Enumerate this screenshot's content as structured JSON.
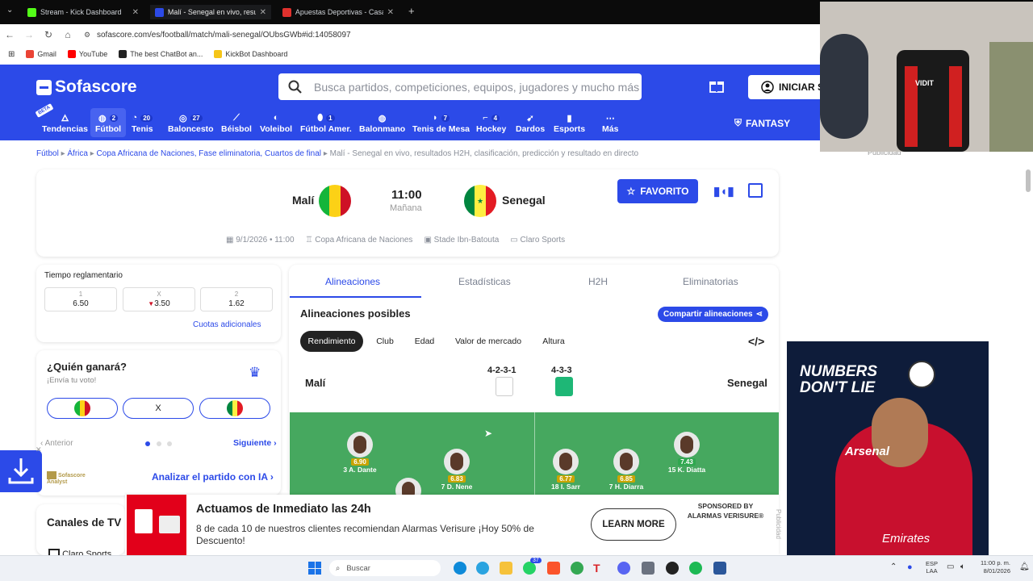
{
  "browser": {
    "tabs": [
      {
        "title": "Stream - Kick Dashboard",
        "color": "#53fc18"
      },
      {
        "title": "Malí - Senegal en vivo, resultado",
        "color": "#2c4ae8"
      },
      {
        "title": "Apuestas Deportivas - Casa de",
        "color": "#e0312d"
      }
    ],
    "url": "sofascore.com/es/football/match/mali-senegal/OUbsGWb#id:14058097",
    "bookmarks": [
      {
        "label": "Gmail",
        "color": "#ea4335"
      },
      {
        "label": "YouTube",
        "color": "#ff0000"
      },
      {
        "label": "The best ChatBot an...",
        "color": "#222222"
      },
      {
        "label": "KickBot Dashboard",
        "color": "#f5c518"
      }
    ]
  },
  "header": {
    "logo": "Sofascore",
    "search_placeholder": "Busca partidos, competiciones, equipos, jugadores y mucho más",
    "login": "INICIAR S",
    "fantasy": "FANTASY",
    "beta": "BETA"
  },
  "sports": [
    {
      "label": "Tendencias",
      "icon": "flame",
      "count": ""
    },
    {
      "label": "Fútbol",
      "icon": "⚽",
      "count": "2"
    },
    {
      "label": "Tenis",
      "icon": "🎾",
      "count": "20"
    },
    {
      "label": "Baloncesto",
      "icon": "🏀",
      "count": "27"
    },
    {
      "label": "Béisbol",
      "icon": "⚾",
      "count": ""
    },
    {
      "label": "Voleibol",
      "icon": "🏐",
      "count": ""
    },
    {
      "label": "Fútbol Amer.",
      "icon": "🏈",
      "count": "1"
    },
    {
      "label": "Balonmano",
      "icon": "🤾",
      "count": ""
    },
    {
      "label": "Tenis de Mesa",
      "icon": "🏓",
      "count": "7"
    },
    {
      "label": "Hockey",
      "icon": "🏒",
      "count": "4"
    },
    {
      "label": "Dardos",
      "icon": "🎯",
      "count": ""
    },
    {
      "label": "Esports",
      "icon": "🎮",
      "count": ""
    },
    {
      "label": "Más",
      "icon": "•••",
      "count": ""
    }
  ],
  "breadcrumb": {
    "items": [
      "Fútbol",
      "África",
      "Copa Africana de Naciones, Fase eliminatoria, Cuartos de final"
    ],
    "current": "Malí - Senegal en vivo, resultados H2H, clasificación, predicción y resultado en directo"
  },
  "match": {
    "home": "Malí",
    "away": "Senegal",
    "time": "11:00",
    "day": "Mañana",
    "favorite": "FAVORITO",
    "date": "9/1/2026 • 11:00",
    "competition": "Copa Africana de Naciones",
    "venue": "Stade Ibn-Batouta",
    "tv": "Claro Sports"
  },
  "odds": {
    "title": "Tiempo reglamentario",
    "items": [
      {
        "label": "1",
        "value": "6.50"
      },
      {
        "label": "X",
        "value": "3.50"
      },
      {
        "label": "2",
        "value": "1.62"
      }
    ],
    "more": "Cuotas adicionales"
  },
  "vote": {
    "title": "¿Quién ganará?",
    "subtitle": "¡Envía tu voto!",
    "draw": "X",
    "prev": "Anterior",
    "next": "Siguiente",
    "analyst": "Sofascore Analyst",
    "ai": "Analizar el partido con IA"
  },
  "tv": {
    "title": "Canales de TV",
    "item": "Claro Sports"
  },
  "lineups": {
    "tabs": [
      "Alineaciones",
      "Estadísticas",
      "H2H",
      "Eliminatorias"
    ],
    "title": "Alineaciones posibles",
    "share": "Compartir alineaciones",
    "chips": [
      "Rendimiento",
      "Club",
      "Edad",
      "Valor de mercado",
      "Altura"
    ],
    "home": "Malí",
    "away": "Senegal",
    "home_formation": "4-2-3-1",
    "away_formation": "4-3-3",
    "players": [
      {
        "name": "3 A. Dante",
        "rating": "6.90",
        "color": "#c9a400"
      },
      {
        "name": "7 D. Nene",
        "rating": "6.83",
        "color": "#c9a400"
      },
      {
        "name": "",
        "rating": "",
        "color": "#c9a400"
      },
      {
        "name": "18 I. Sarr",
        "rating": "6.77",
        "color": "#c9a400"
      },
      {
        "name": "7 H. Diarra",
        "rating": "6.85",
        "color": "#c9a400"
      },
      {
        "name": "15 K. Diatta",
        "rating": "7.43",
        "color": "#2fa84f"
      }
    ]
  },
  "ad": {
    "title": "Actuamos de Inmediato las 24h",
    "body": "8 de cada 10 de nuestros clientes recomiendan Alarmas Verisure ¡Hoy 50% de Descuento!",
    "cta": "LEARN MORE",
    "sponsor": "SPONSORED BY ALARMAS VERISURE®",
    "side_label": "Publicidad"
  },
  "side_ad": {
    "line1": "NUMBERS",
    "line2": "DON'T LIE",
    "club": "Arsenal",
    "sponsor": "Emirates"
  },
  "webcam": {
    "label": "VIDIT"
  },
  "taskbar": {
    "search": "Buscar",
    "lang": "ESP",
    "lang2": "LAA",
    "time": "11:00 p. m.",
    "date": "8/01/2026",
    "badge": "37"
  },
  "colors": {
    "brand": "#2c4ae8",
    "pitch": "#46a85f",
    "mali_green": "#14b53a",
    "mali_yellow": "#fcd116",
    "mali_red": "#ce1126",
    "senegal_green": "#00853f"
  }
}
